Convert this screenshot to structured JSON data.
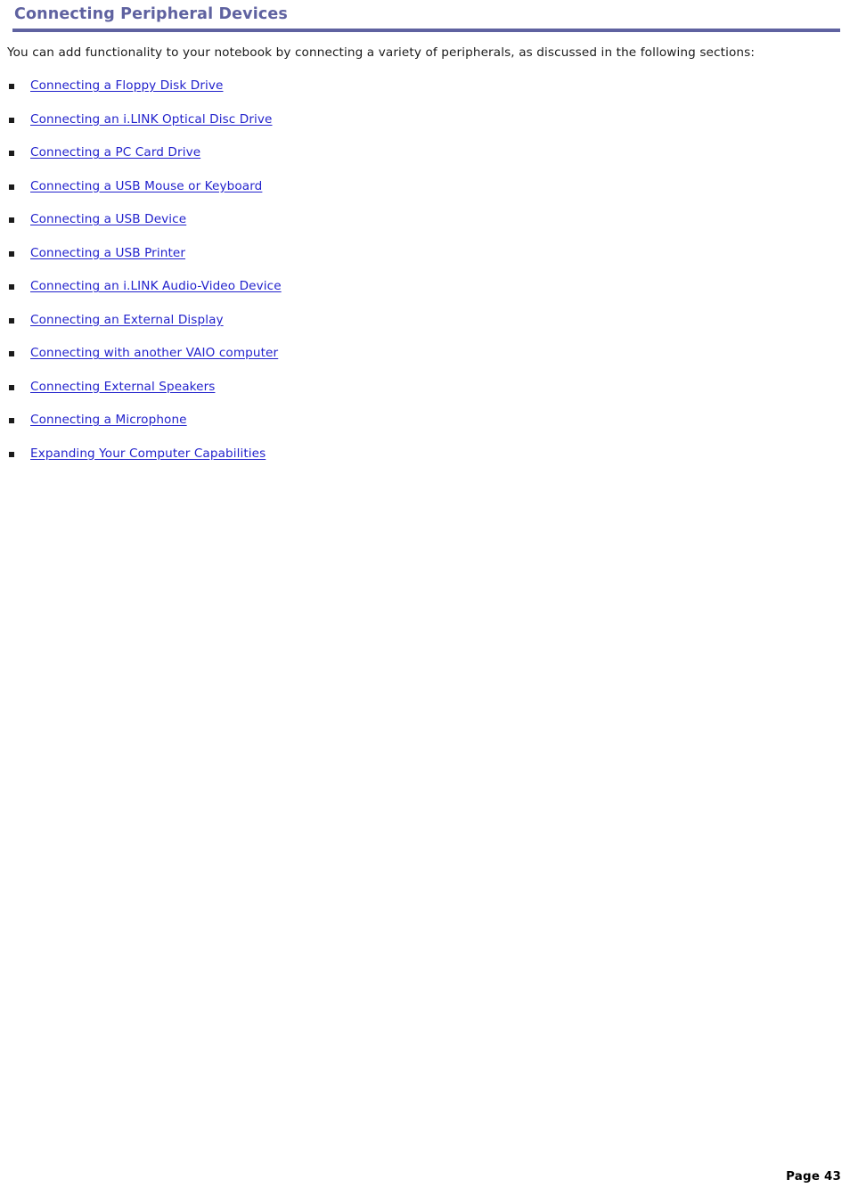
{
  "document": {
    "title": "Connecting Peripheral Devices",
    "intro": "You can add functionality to your notebook by connecting a variety of peripherals, as discussed in the following sections:",
    "links": [
      {
        "label": "Connecting a Floppy Disk Drive"
      },
      {
        "label": "Connecting an i.LINK Optical Disc Drive"
      },
      {
        "label": "Connecting a PC Card Drive"
      },
      {
        "label": "Connecting a USB Mouse or Keyboard"
      },
      {
        "label": "Connecting a USB Device"
      },
      {
        "label": "Connecting a USB Printer"
      },
      {
        "label": "Connecting an i.LINK Audio-Video Device"
      },
      {
        "label": "Connecting an External Display"
      },
      {
        "label": "Connecting with another VAIO computer"
      },
      {
        "label": "Connecting External Speakers"
      },
      {
        "label": "Connecting a Microphone"
      },
      {
        "label": "Expanding Your Computer Capabilities"
      }
    ],
    "footer": {
      "page_label": "Page 43"
    },
    "colors": {
      "title": "#5f62a0",
      "rule": "#5f62a0",
      "link": "#2222cc",
      "bullet": "#1c1c1c",
      "body_text": "#1a1a1a",
      "background": "#ffffff"
    },
    "icons": {
      "bullet": "square-bullet-icon"
    }
  }
}
